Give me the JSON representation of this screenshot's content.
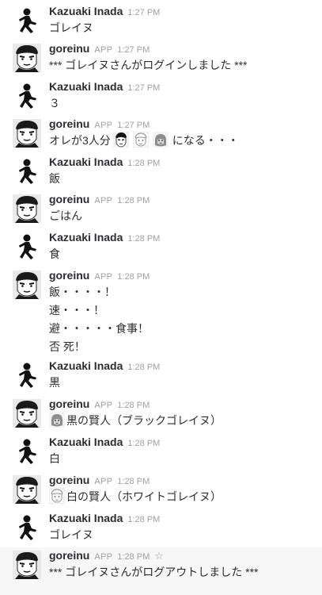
{
  "users": {
    "kazuaki": "Kazuaki Inada",
    "goreinu": "goreinu"
  },
  "app_badge": "APP",
  "messages": [
    {
      "user": "kazuaki",
      "time": "1:27 PM",
      "lines": [
        "ゴレイヌ"
      ]
    },
    {
      "user": "goreinu",
      "app": true,
      "time": "1:27 PM",
      "lines": [
        "*** ゴレイヌさんがログインしました ***"
      ]
    },
    {
      "user": "kazuaki",
      "time": "1:27 PM",
      "lines": [
        "３"
      ]
    },
    {
      "user": "goreinu",
      "app": true,
      "time": "1:27 PM",
      "lines": [
        "オレが3人分",
        "になる・・・"
      ],
      "emojis": [
        "face-emoji",
        "white-face-emoji",
        "gorilla-emoji"
      ]
    },
    {
      "user": "kazuaki",
      "time": "1:28 PM",
      "lines": [
        "飯"
      ]
    },
    {
      "user": "goreinu",
      "app": true,
      "time": "1:28 PM",
      "lines": [
        "ごはん"
      ]
    },
    {
      "user": "kazuaki",
      "time": "1:28 PM",
      "lines": [
        "食"
      ]
    },
    {
      "user": "goreinu",
      "app": true,
      "time": "1:28 PM",
      "lines": [
        "飯・・・・！",
        "速・・・！",
        "避・・・・・食事！",
        "否 死！"
      ]
    },
    {
      "user": "kazuaki",
      "time": "1:28 PM",
      "lines": [
        "黒"
      ]
    },
    {
      "user": "goreinu",
      "app": true,
      "time": "1:28 PM",
      "lines": [
        "黒の賢人（ブラックゴレイヌ）"
      ],
      "lead_emoji": "gorilla-emoji"
    },
    {
      "user": "kazuaki",
      "time": "1:28 PM",
      "lines": [
        "白"
      ]
    },
    {
      "user": "goreinu",
      "app": true,
      "time": "1:28 PM",
      "lines": [
        "白の賢人（ホワイトゴレイヌ）"
      ],
      "lead_emoji": "white-face-emoji"
    },
    {
      "user": "kazuaki",
      "time": "1:28 PM",
      "lines": [
        "ゴレイヌ"
      ]
    },
    {
      "user": "goreinu",
      "app": true,
      "time": "1:28 PM",
      "lines": [
        "*** ゴレイヌさんがログアウトしました ***"
      ],
      "star": "☆",
      "hover": true
    }
  ]
}
